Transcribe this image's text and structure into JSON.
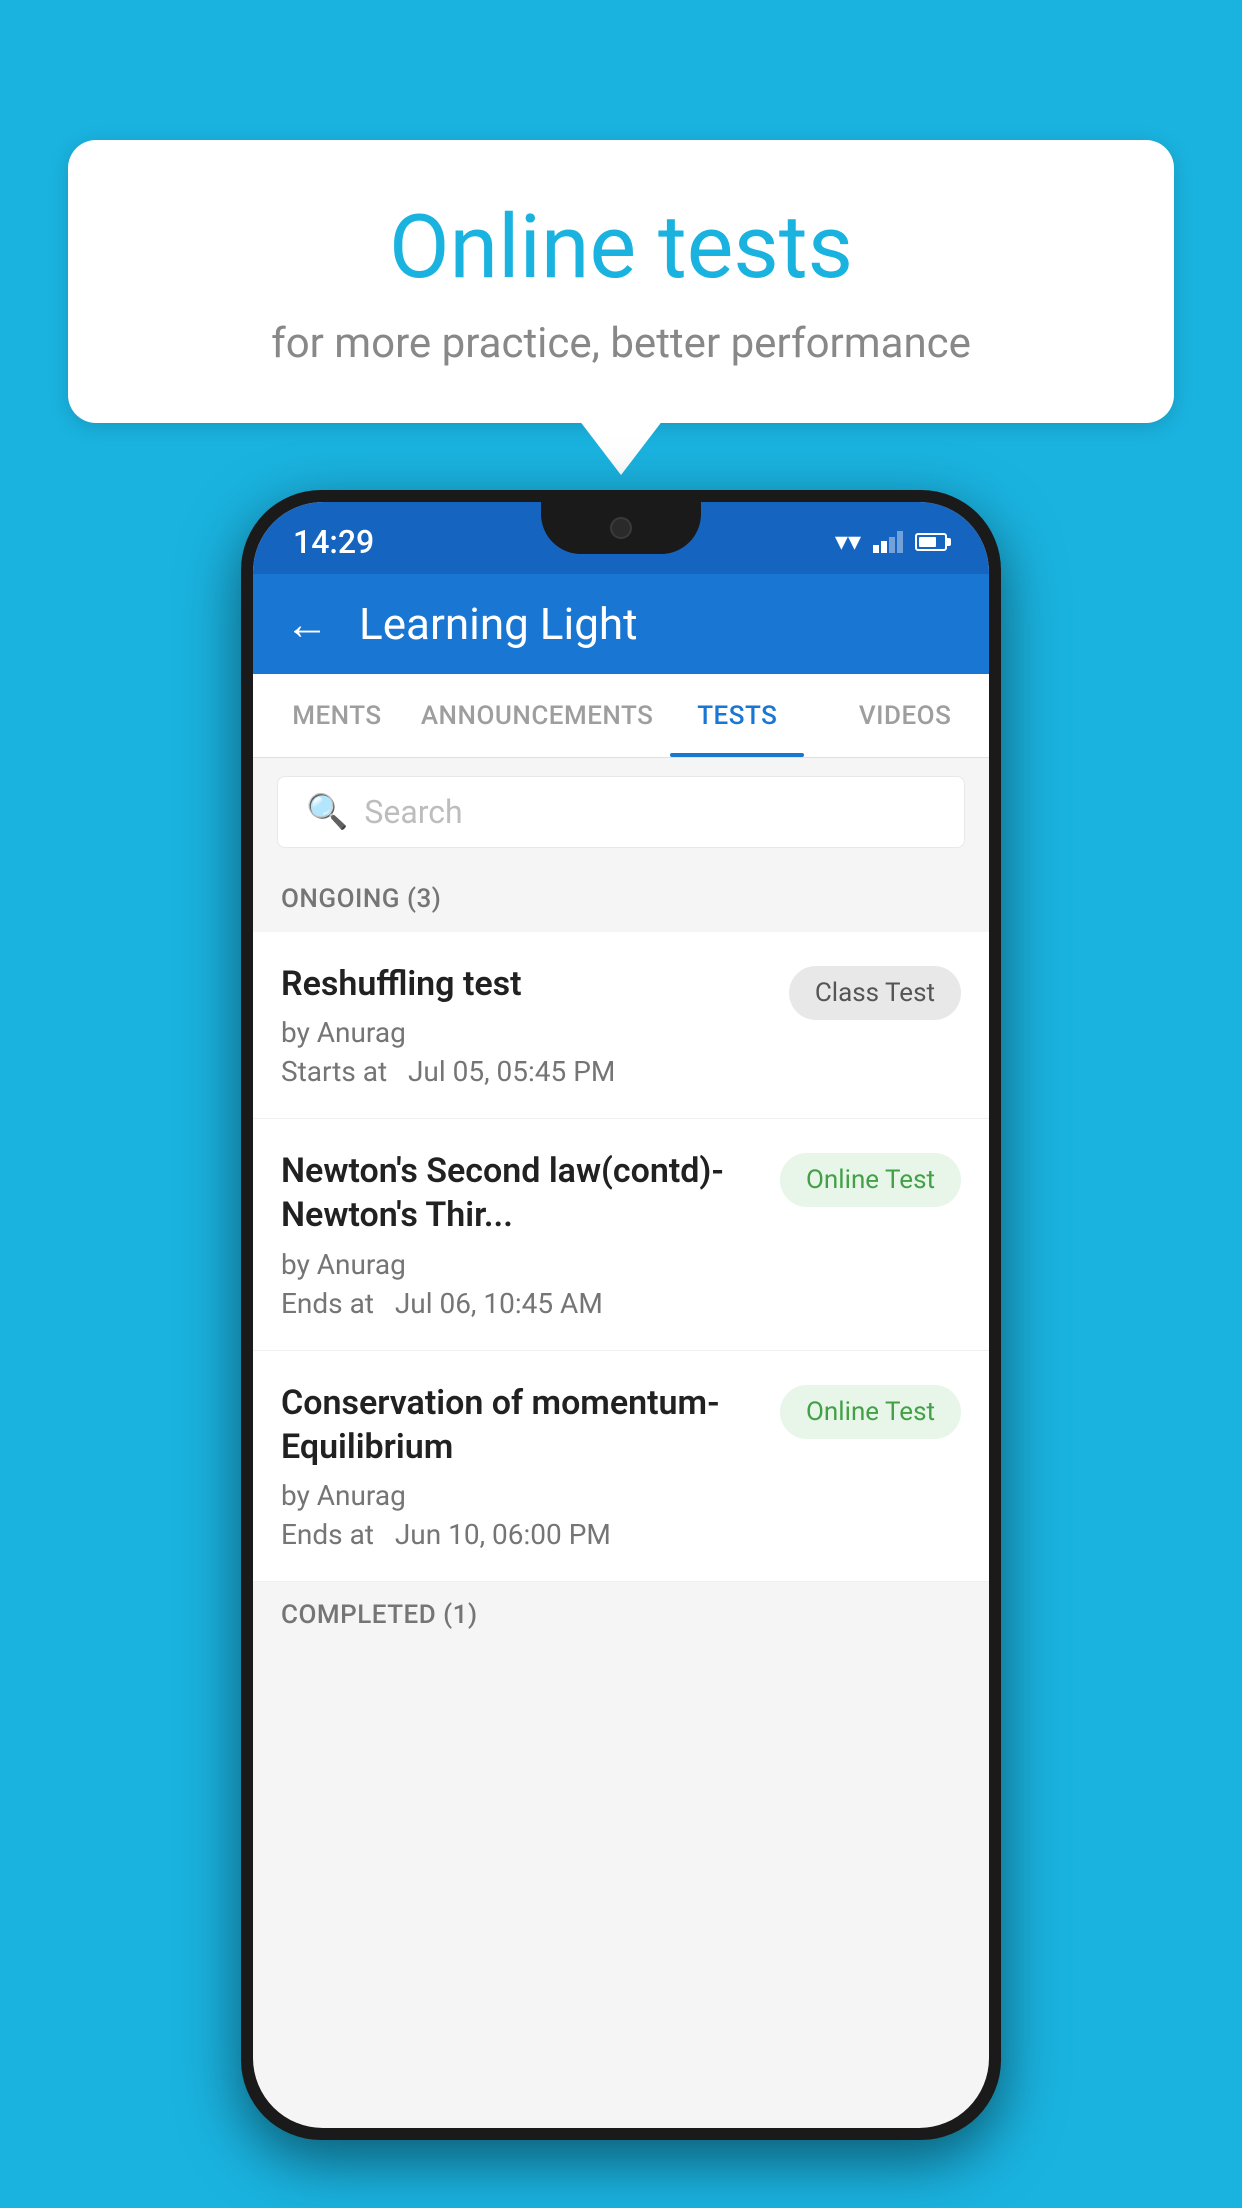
{
  "background": {
    "color": "#1ab3e0"
  },
  "speech_bubble": {
    "title": "Online tests",
    "subtitle": "for more practice, better performance"
  },
  "phone": {
    "status_bar": {
      "time": "14:29"
    },
    "app_bar": {
      "back_label": "←",
      "title": "Learning Light"
    },
    "tabs": [
      {
        "id": "ments",
        "label": "MENTS",
        "active": false
      },
      {
        "id": "announcements",
        "label": "ANNOUNCEMENTS",
        "active": false
      },
      {
        "id": "tests",
        "label": "TESTS",
        "active": true
      },
      {
        "id": "videos",
        "label": "VIDEOS",
        "active": false
      }
    ],
    "search": {
      "placeholder": "Search"
    },
    "ongoing_section": {
      "label": "ONGOING (3)",
      "tests": [
        {
          "name": "Reshuffling test",
          "author": "by Anurag",
          "time_label": "Starts at",
          "time": "Jul 05, 05:45 PM",
          "badge": "Class Test",
          "badge_type": "class"
        },
        {
          "name": "Newton's Second law(contd)-Newton's Thir...",
          "author": "by Anurag",
          "time_label": "Ends at",
          "time": "Jul 06, 10:45 AM",
          "badge": "Online Test",
          "badge_type": "online"
        },
        {
          "name": "Conservation of momentum-Equilibrium",
          "author": "by Anurag",
          "time_label": "Ends at",
          "time": "Jun 10, 06:00 PM",
          "badge": "Online Test",
          "badge_type": "online"
        }
      ]
    },
    "completed_section": {
      "label": "COMPLETED (1)"
    }
  }
}
